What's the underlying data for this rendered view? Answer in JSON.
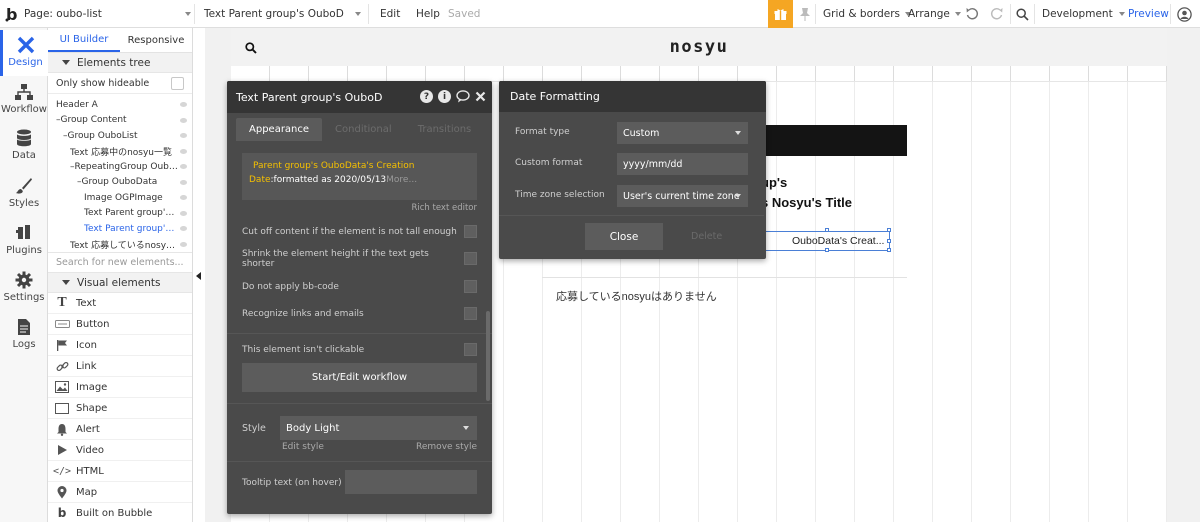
{
  "topbar": {
    "page_label": "Page: oubo-list",
    "element_selector": "Text Parent group's OuboD",
    "edit": "Edit",
    "help": "Help",
    "saved": "Saved",
    "grid_borders": "Grid & borders",
    "arrange": "Arrange",
    "development": "Development",
    "preview": "Preview"
  },
  "rail": {
    "items": [
      {
        "label": "Design",
        "icon": "design-icon"
      },
      {
        "label": "Workflow",
        "icon": "workflow-icon"
      },
      {
        "label": "Data",
        "icon": "database-icon"
      },
      {
        "label": "Styles",
        "icon": "brush-icon"
      },
      {
        "label": "Plugins",
        "icon": "plug-icon"
      },
      {
        "label": "Settings",
        "icon": "gear-icon"
      },
      {
        "label": "Logs",
        "icon": "document-icon"
      }
    ]
  },
  "panel": {
    "tab_ui_builder": "UI Builder",
    "tab_responsive": "Responsive",
    "elements_tree": "Elements tree",
    "only_hideable": "Only show hideable",
    "tree": [
      {
        "label": "Header A",
        "indent": 0
      },
      {
        "label": "–Group Content",
        "indent": 0
      },
      {
        "label": "–Group OuboList",
        "indent": 1
      },
      {
        "label": "Text 応募中のnosyu一覧",
        "indent": 2
      },
      {
        "label": "–RepeatingGroup Oubo...",
        "indent": 2
      },
      {
        "label": "–Group OuboData",
        "indent": 3
      },
      {
        "label": "Image OGPImage",
        "indent": 4
      },
      {
        "label": "Text Parent group's ...",
        "indent": 4
      },
      {
        "label": "Text Parent group's ...",
        "indent": 4,
        "selected": true
      },
      {
        "label": "Text 応募しているnosyu...",
        "indent": 2
      }
    ],
    "search_placeholder": "Search for new elements...",
    "visual_elements": "Visual elements",
    "visual": [
      {
        "label": "Text",
        "icon": "text-icon"
      },
      {
        "label": "Button",
        "icon": "button-icon"
      },
      {
        "label": "Icon",
        "icon": "flag-icon"
      },
      {
        "label": "Link",
        "icon": "link-icon"
      },
      {
        "label": "Image",
        "icon": "image-icon"
      },
      {
        "label": "Shape",
        "icon": "shape-icon"
      },
      {
        "label": "Alert",
        "icon": "bell-icon"
      },
      {
        "label": "Video",
        "icon": "video-icon"
      },
      {
        "label": "HTML",
        "icon": "code-icon"
      },
      {
        "label": "Map",
        "icon": "map-pin-icon"
      },
      {
        "label": "Built on Bubble",
        "icon": "bubble-icon"
      }
    ]
  },
  "canvas": {
    "brand": "nosyu",
    "group_title_1": "up's",
    "group_title_2": "s Nosyu's Title",
    "selected_text": "OuboData's Creat...",
    "empty_message": "応募しているnosyuはありません"
  },
  "props": {
    "title": "Text Parent group's OuboD",
    "tabs": [
      "Appearance",
      "Conditional",
      "Transitions"
    ],
    "dynamic_orange": "Parent group's OuboData's Creation",
    "dynamic_orange_2": "Date",
    "dynamic_white": ":formatted as 2020/05/13",
    "dynamic_more": "More...",
    "rich_text_editor": "Rich text editor",
    "options": [
      "Cut off content if the element is not tall enough",
      "Shrink the element height if the text gets shorter",
      "Do not apply bb-code",
      "Recognize links and emails",
      "This element isn't clickable"
    ],
    "workflow_button": "Start/Edit workflow",
    "style_label": "Style",
    "style_value": "Body Light",
    "edit_style": "Edit style",
    "remove_style": "Remove style",
    "tooltip_label": "Tooltip text (on hover)"
  },
  "date_formatting": {
    "title": "Date Formatting",
    "format_type_label": "Format type",
    "format_type_value": "Custom",
    "custom_format_label": "Custom format",
    "custom_format_value": "yyyy/mm/dd",
    "timezone_label": "Time zone selection",
    "timezone_value": "User's current time zone",
    "close": "Close",
    "delete": "Delete"
  },
  "colors": {
    "accent": "#2a64e8",
    "gift": "#f5a623",
    "dynamic_text": "#f5c000",
    "panel_dark": "#4a4a4a"
  }
}
